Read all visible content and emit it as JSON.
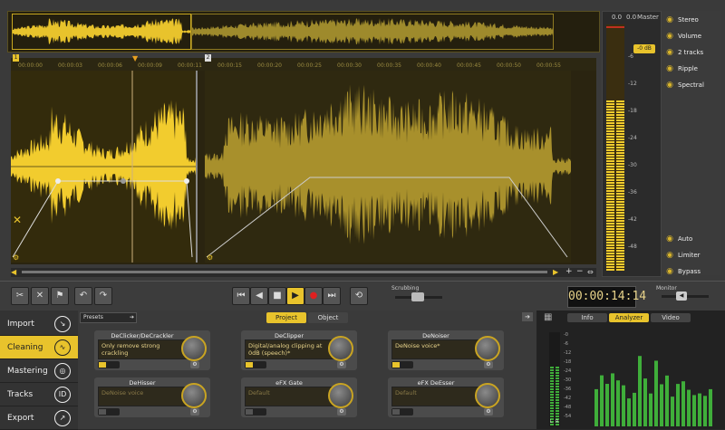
{
  "ruler": {
    "marker1": "1",
    "marker2": "2",
    "ticks1": [
      "00:00:00",
      "00:00:03",
      "00:00:06",
      "00:00:09",
      "00:00:11"
    ],
    "ticks2": [
      "00:00:15",
      "00:00:20",
      "00:00:25",
      "00:00:30",
      "00:00:35",
      "00:00:40",
      "00:00:45",
      "00:00:50",
      "00:00:55"
    ]
  },
  "meter": {
    "peak_left": "0.0",
    "peak_right": "0.0",
    "master_label": "Master",
    "db_value": "-0 dB",
    "scale": [
      "-6",
      "-12",
      "-18",
      "-24",
      "-30",
      "-36",
      "-42",
      "-48"
    ]
  },
  "view_panel": {
    "items": [
      {
        "label": "Stereo",
        "icon": "stereo-icon"
      },
      {
        "label": "Volume",
        "icon": "volume-curve-icon"
      },
      {
        "label": "2 tracks",
        "icon": "two-tracks-icon"
      },
      {
        "label": "Ripple",
        "icon": "ripple-icon"
      },
      {
        "label": "Spectral",
        "icon": "spectral-icon"
      }
    ],
    "bottom": [
      {
        "label": "Auto",
        "icon": "auto-icon"
      },
      {
        "label": "Limiter",
        "icon": "limiter-icon"
      },
      {
        "label": "Bypass",
        "icon": "bypass-icon"
      }
    ]
  },
  "transport": {
    "scrubbing_label": "Scrubbing",
    "monitor_label": "Monitor",
    "timecode": "00:00:14:14"
  },
  "nav": {
    "items": [
      {
        "label": "Import",
        "icon": "import-icon",
        "active": false
      },
      {
        "label": "Cleaning",
        "icon": "cleaning-icon",
        "active": true
      },
      {
        "label": "Mastering",
        "icon": "mastering-icon",
        "active": false
      },
      {
        "label": "Tracks",
        "icon": "tracks-icon",
        "active": false
      },
      {
        "label": "Export",
        "icon": "export-icon",
        "active": false
      }
    ]
  },
  "modules_panel": {
    "presets_label": "Presets",
    "tab_project": "Project",
    "tab_object": "Object",
    "modules": [
      {
        "title": "DeClicker/DeCrackler",
        "value": "Only remove strong crackling",
        "enabled": true
      },
      {
        "title": "DeClipper",
        "value": "Digital/analog clipping at 0dB (speech)*",
        "enabled": true
      },
      {
        "title": "DeNoiser",
        "value": "DeNoise voice*",
        "enabled": true
      },
      {
        "title": "DeHisser",
        "value": "DeNoise voice",
        "enabled": false
      },
      {
        "title": "eFX Gate",
        "value": "Default",
        "enabled": false
      },
      {
        "title": "eFX DeEsser",
        "value": "Default",
        "enabled": false
      }
    ]
  },
  "analyzer_panel": {
    "tabs": [
      "Info",
      "Analyzer",
      "Video"
    ],
    "active_tab": "Analyzer",
    "scale": [
      "-0",
      "-6",
      "-12",
      "-18",
      "-24",
      "-30",
      "-36",
      "-42",
      "-48",
      "-54"
    ],
    "lr": [
      "L",
      "R"
    ]
  },
  "colors": {
    "accent": "#e8c32c",
    "wave_active": "#f2cc2e",
    "wave_dim": "#a8902c"
  }
}
